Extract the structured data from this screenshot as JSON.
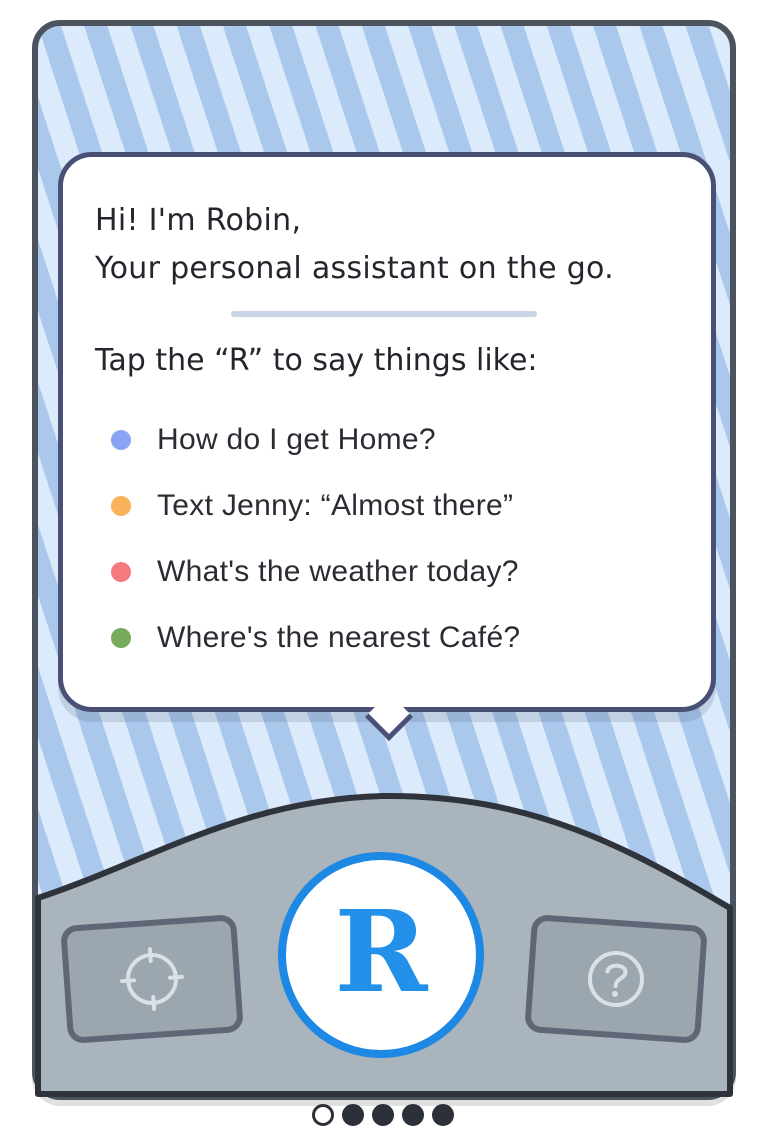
{
  "bubble": {
    "greeting_line1": "Hi! I'm Robin,",
    "greeting_line2": "Your personal assistant on the go.",
    "tap_heading": "Tap the “R” to say things like:",
    "examples": [
      {
        "text": "How do I get Home?",
        "color": "#8aa4f4"
      },
      {
        "text": "Text Jenny: “Almost there”",
        "color": "#f8b35a"
      },
      {
        "text": "What's the weather today?",
        "color": "#f57a7f"
      },
      {
        "text": "Where's the nearest Café?",
        "color": "#78aa5c"
      }
    ]
  },
  "controls": {
    "main_button_letter": "R",
    "left_icon": "crosshair-icon",
    "right_icon": "help-icon"
  },
  "pagination": {
    "total": 5,
    "current": 1
  },
  "colors": {
    "accent": "#1e88e5",
    "stripe_light": "#dcebfb",
    "stripe_dark": "#a9c8ec",
    "panel": "#a9b4bd",
    "outline": "#4d535e"
  }
}
